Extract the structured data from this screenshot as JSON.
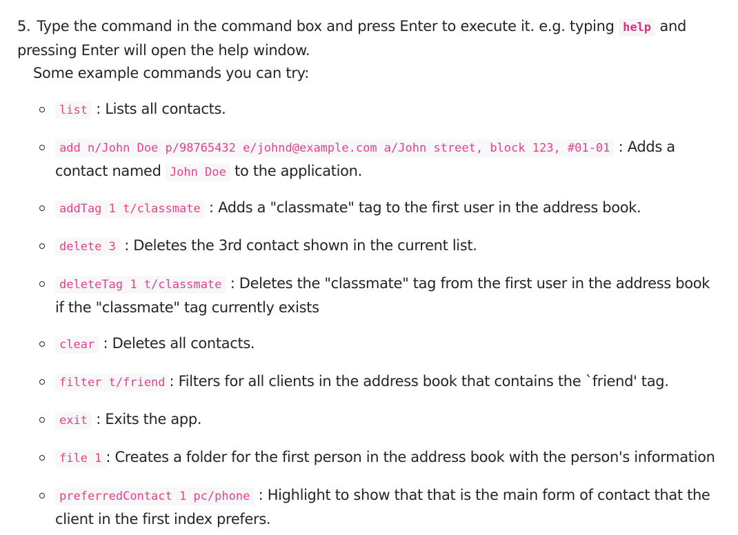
{
  "step": {
    "number": "5.",
    "text_before": "Type the command in the command box and press Enter to execute it. e.g. typing",
    "code": "help",
    "text_after": "and pressing Enter will open the help window.",
    "line2": "Some example commands you can try:"
  },
  "commands": [
    {
      "code": "list",
      "desc": ": Lists all contacts."
    },
    {
      "code": "add n/John Doe p/98765432 e/johnd@example.com a/John street, block 123, #01-01",
      "desc": ": Adds a contact named",
      "code2": "John Doe",
      "desc2": "to the application."
    },
    {
      "code": "addTag 1 t/classmate",
      "desc": ": Adds a \"classmate\" tag to the first user in the address book."
    },
    {
      "code": "delete 3",
      "desc": ": Deletes the 3rd contact shown in the current list."
    },
    {
      "code": "deleteTag 1 t/classmate",
      "desc": ": Deletes the \"classmate\" tag from the first user in the address book if the \"classmate\" tag currently exists"
    },
    {
      "code": "clear",
      "desc": ": Deletes all contacts."
    },
    {
      "code": "filter t/friend",
      "desc": ": Filters for all clients in the address book that contains the `friend' tag."
    },
    {
      "code": "exit",
      "desc": ": Exits the app."
    },
    {
      "code": "file 1",
      "desc": ": Creates a folder for the first person in the address book with the person's information"
    },
    {
      "code": "preferredContact 1 pc/phone",
      "desc": ": Highlight to show that that is the main form of contact that the client in the first index prefers."
    }
  ]
}
